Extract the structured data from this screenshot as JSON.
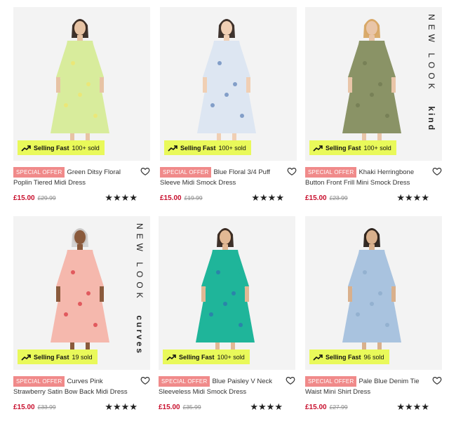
{
  "products": [
    {
      "badge": "SPECIAL OFFER",
      "title": "Green Ditsy Floral Poplin Tiered Midi Dress",
      "price": "£15.00",
      "was_price": "£29.99",
      "selling_label": "Selling Fast",
      "sold": "100+ sold",
      "brand_lines": [],
      "rating": 4,
      "stars": "★★★★",
      "dress_color": "#d8ec9c",
      "dress_accent": "#f3e56a"
    },
    {
      "badge": "SPECIAL OFFER",
      "title": "Blue Floral 3/4 Puff Sleeve Midi Smock Dress",
      "price": "£15.00",
      "was_price": "£19.99",
      "selling_label": "Selling Fast",
      "sold": "100+ sold",
      "brand_lines": [],
      "rating": 4,
      "stars": "★★★★",
      "dress_color": "#dde6f2",
      "dress_accent": "#5b7fb6"
    },
    {
      "badge": "SPECIAL OFFER",
      "title": "Khaki Herringbone Button Front Frill Mini Smock Dress",
      "price": "£15.00",
      "was_price": "£23.99",
      "selling_label": "Selling Fast",
      "sold": "100+ sold",
      "brand_lines": [
        "NEW LOOK",
        "kind"
      ],
      "rating": 4,
      "stars": "★★★★",
      "dress_color": "#8a9366",
      "dress_accent": "#6f7850"
    },
    {
      "badge": "SPECIAL OFFER",
      "title": "Curves Pink Strawberry Satin Bow Back Midi Dress",
      "price": "£15.00",
      "was_price": "£33.99",
      "selling_label": "Selling Fast",
      "sold": "19 sold",
      "brand_lines": [
        "NEW LOOK",
        "curves"
      ],
      "rating": 4.5,
      "stars": "★★★★",
      "dress_color": "#f5b8ad",
      "dress_accent": "#d8323c"
    },
    {
      "badge": "SPECIAL OFFER",
      "title": "Blue Paisley V Neck Sleeveless Midi Smock Dress",
      "price": "£15.00",
      "was_price": "£35.99",
      "selling_label": "Selling Fast",
      "sold": "100+ sold",
      "brand_lines": [],
      "rating": 4.5,
      "stars": "★★★★",
      "dress_color": "#1fb59a",
      "dress_accent": "#2f6fb0"
    },
    {
      "badge": "SPECIAL OFFER",
      "title": "Pale Blue Denim Tie Waist Mini Shirt Dress",
      "price": "£15.00",
      "was_price": "£27.99",
      "selling_label": "Selling Fast",
      "sold": "96 sold",
      "brand_lines": [],
      "rating": 4.5,
      "stars": "★★★★",
      "dress_color": "#a9c3df",
      "dress_accent": "#8aa9c9"
    }
  ]
}
